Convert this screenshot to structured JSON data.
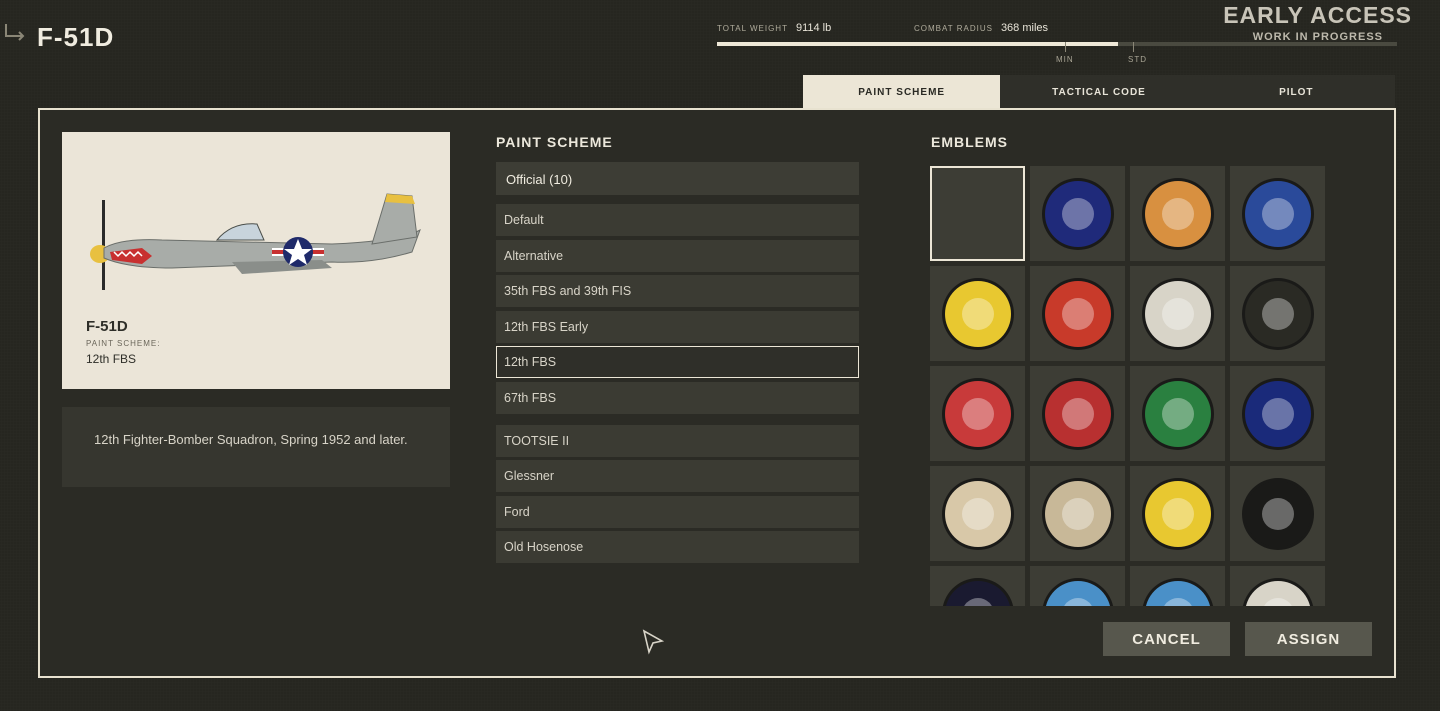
{
  "header": {
    "aircraft_name": "F-51D",
    "early_access_title": "EARLY ACCESS",
    "early_access_sub": "WORK IN PROGRESS"
  },
  "stats": {
    "total_weight_label": "TOTAL WEIGHT",
    "total_weight_value": "9114 lb",
    "combat_radius_label": "COMBAT RADIUS",
    "combat_radius_value": "368 miles",
    "min_label": "MIN",
    "std_label": "STD",
    "fill_fraction": 0.589
  },
  "tabs": [
    {
      "label": "PAINT SCHEME",
      "active": true
    },
    {
      "label": "TACTICAL CODE",
      "active": false
    },
    {
      "label": "PILOT",
      "active": false
    }
  ],
  "preview": {
    "name": "F-51D",
    "scheme_label": "PAINT SCHEME:",
    "scheme_value": "12th FBS"
  },
  "description": "12th Fighter-Bomber Squadron, Spring 1952 and later.",
  "paint_scheme": {
    "title": "PAINT SCHEME",
    "dropdown_value": "Official (10)",
    "items": [
      {
        "label": "Default"
      },
      {
        "label": "Alternative"
      },
      {
        "label": "35th FBS and 39th FIS"
      },
      {
        "label": "12th FBS Early"
      },
      {
        "label": "12th FBS"
      },
      {
        "label": "67th FBS"
      },
      {
        "label": "TOOTSIE II"
      },
      {
        "label": "Glessner"
      },
      {
        "label": "Ford"
      },
      {
        "label": "Old Hosenose"
      }
    ],
    "selected_index": 4
  },
  "emblems": {
    "title": "EMBLEMS",
    "items": [
      {
        "name": "empty-emblem",
        "color": "#3d3d35"
      },
      {
        "name": "star-emblem",
        "color": "#1f2a7a"
      },
      {
        "name": "tiger-emblem",
        "color": "#d89040"
      },
      {
        "name": "chief-shield-emblem",
        "color": "#2a4a9a"
      },
      {
        "name": "eagle-yellow-emblem",
        "color": "#e8c830"
      },
      {
        "name": "shield-axe-emblem",
        "color": "#c83a2a"
      },
      {
        "name": "duck-rocket-emblem",
        "color": "#d8d4c8"
      },
      {
        "name": "eagle-star-emblem",
        "color": "#2a2a24"
      },
      {
        "name": "red-shield-emblem",
        "color": "#c83a3a"
      },
      {
        "name": "donkey-emblem",
        "color": "#b83030"
      },
      {
        "name": "green-dragon-emblem",
        "color": "#2a8040"
      },
      {
        "name": "red-blue-emblem",
        "color": "#1a2a7a"
      },
      {
        "name": "native-warrior-emblem",
        "color": "#d8c8a8"
      },
      {
        "name": "sailor-emblem",
        "color": "#c8b898"
      },
      {
        "name": "yellow-bird-emblem",
        "color": "#e8c830"
      },
      {
        "name": "headdress-emblem",
        "color": "#1a1a18"
      },
      {
        "name": "dark-emblem",
        "color": "#1a1a30"
      },
      {
        "name": "fox-emblem",
        "color": "#4a90c8"
      },
      {
        "name": "rabbit-emblem",
        "color": "#4a90c8"
      },
      {
        "name": "bat-emblem",
        "color": "#d8d4c8"
      }
    ]
  },
  "buttons": {
    "cancel": "CANCEL",
    "assign": "ASSIGN"
  }
}
